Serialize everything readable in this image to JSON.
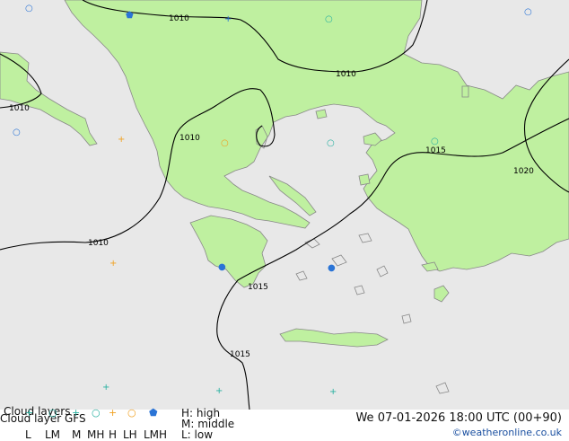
{
  "map": {
    "colors": {
      "sea": "#e8e8e8",
      "land": "#bff0a0",
      "coast": "#888888",
      "isobar": "#000000",
      "symbol_high": "#2a74d6",
      "symbol_mid": "#27b0a0",
      "symbol_low": "#f0a020"
    },
    "isobar_labels": [
      "1010",
      "1010",
      "1010",
      "1010",
      "1010",
      "1015",
      "1015",
      "1015",
      "1020"
    ]
  },
  "legend": {
    "title": "Cloud layers",
    "subtitle": "Cloud layer GFS",
    "keys": [
      "L",
      "LM",
      "M",
      "MH",
      "H",
      "LH",
      "LMH"
    ],
    "levels": [
      "H: high",
      "M: middle",
      "L: low"
    ],
    "datetime": "We 07-01-2026 18:00 UTC (00+90)",
    "credit": "©weatheronline.co.uk"
  }
}
